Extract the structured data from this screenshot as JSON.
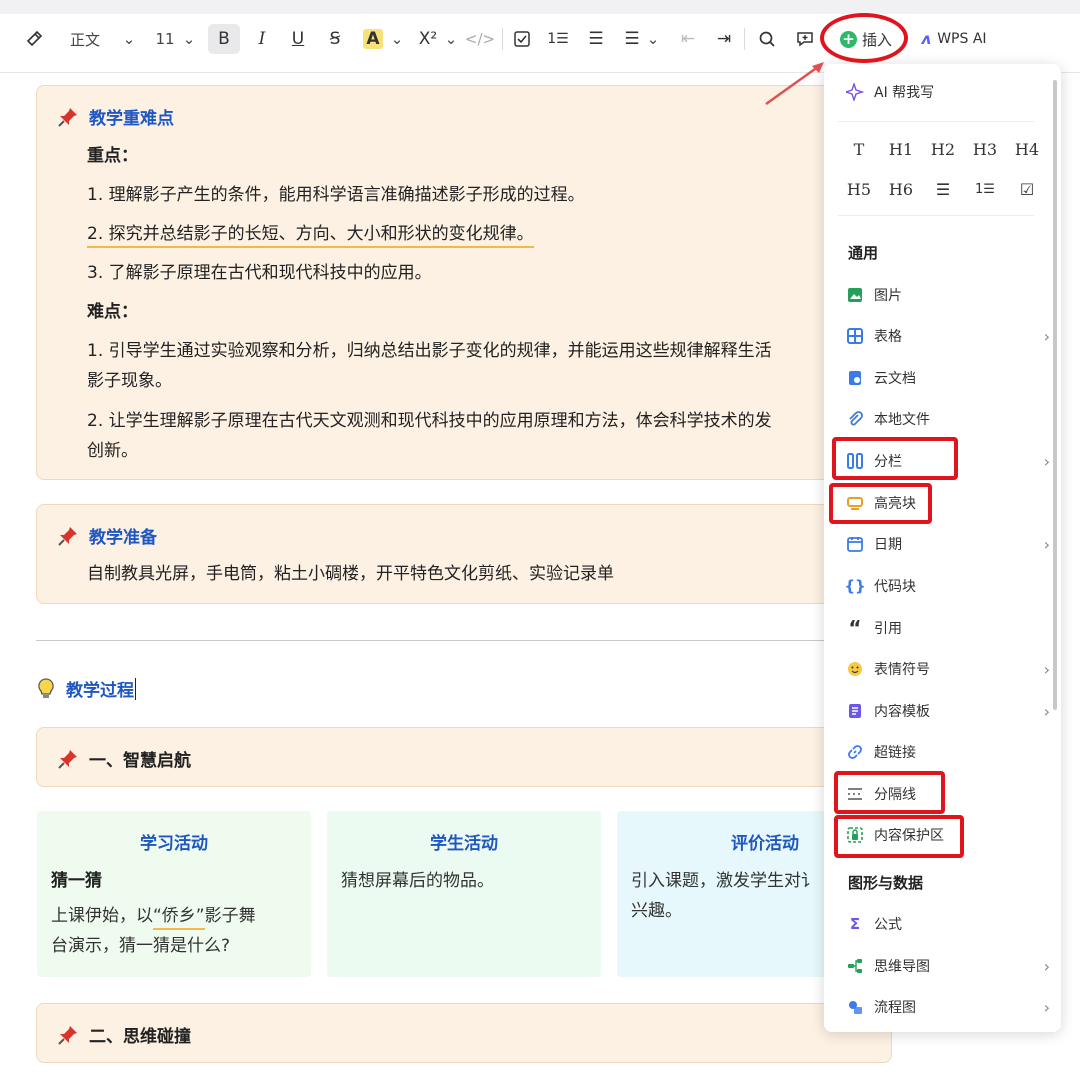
{
  "toolbar": {
    "style_select": "正文",
    "font_size": "11",
    "bold_icon": "B",
    "italic_icon": "I",
    "underline_icon": "U",
    "strike_icon": "Ꞩ",
    "highlight_icon": "A",
    "superscript_icon": "X²",
    "code_icon": "</>",
    "insert_label": "插入",
    "ai_label": "WPS AI"
  },
  "document": {
    "block1": {
      "title": "教学重难点",
      "key_label": "重点：",
      "key_points": [
        "1. 理解影子产生的条件，能用科学语言准确描述影子形成的过程。",
        "2. 探究并总结影子的长短、方向、大小和形状的变化规律。",
        "3. 了解影子原理在古代和现代科技中的应用。"
      ],
      "diff_label": "难点：",
      "diff_points": [
        "1. 引导学生通过实验观察和分析，归纳总结出影子变化的规律，并能运用这些规律解释生活",
        "影子现象。",
        "2. 让学生理解影子原理在古代天文观测和现代科技中的应用原理和方法，体会科学技术的发",
        "创新。"
      ]
    },
    "block2": {
      "title": "教学准备",
      "text": "自制教具光屏，手电筒，粘土小碉楼，开平特色文化剪纸、实验记录单"
    },
    "section_title": "教学过程",
    "step1_title": "一、智慧启航",
    "step2_title": "二、思维碰撞",
    "cards": [
      {
        "head": "学习活动",
        "sub": "猜一猜",
        "text1": "上课伊始，以",
        "quote": "“侨乡”",
        "text2": "影子舞",
        "text3": "台演示，猜一猜是什么?"
      },
      {
        "head": "学生活动",
        "text": "猜想屏幕后的物品。"
      },
      {
        "head": "评价活动",
        "text": "引入课题，激发学生对讠",
        "text2": "兴趣。"
      }
    ]
  },
  "menu": {
    "ai_write": "AI 帮我写",
    "formats": [
      "T",
      "H1",
      "H2",
      "H3",
      "H4",
      "H5",
      "H6",
      "☰",
      "1☰",
      "☑"
    ],
    "section_general": "通用",
    "items": [
      {
        "label": "图片",
        "icon": "image-icon"
      },
      {
        "label": "表格",
        "icon": "table-icon"
      },
      {
        "label": "云文档",
        "icon": "cloud-doc-icon"
      },
      {
        "label": "本地文件",
        "icon": "attachment-icon"
      },
      {
        "label": "分栏",
        "icon": "columns-icon"
      },
      {
        "label": "高亮块",
        "icon": "highlight-block-icon"
      },
      {
        "label": "日期",
        "icon": "calendar-icon"
      },
      {
        "label": "代码块",
        "icon": "code-block-icon"
      },
      {
        "label": "引用",
        "icon": "quote-icon"
      },
      {
        "label": "表情符号",
        "icon": "emoji-icon"
      },
      {
        "label": "内容模板",
        "icon": "template-icon"
      },
      {
        "label": "超链接",
        "icon": "link-icon"
      },
      {
        "label": "分隔线",
        "icon": "divider-icon"
      },
      {
        "label": "内容保护区",
        "icon": "protect-icon"
      }
    ],
    "section_graph": "图形与数据",
    "graph_items": [
      {
        "label": "公式",
        "icon": "formula-icon"
      },
      {
        "label": "思维导图",
        "icon": "mindmap-icon"
      },
      {
        "label": "流程图",
        "icon": "flowchart-icon"
      }
    ]
  },
  "colors": {
    "accent_red": "#e0141c",
    "heading_blue": "#1e57c2",
    "callout_bg": "#fcf1e3"
  }
}
